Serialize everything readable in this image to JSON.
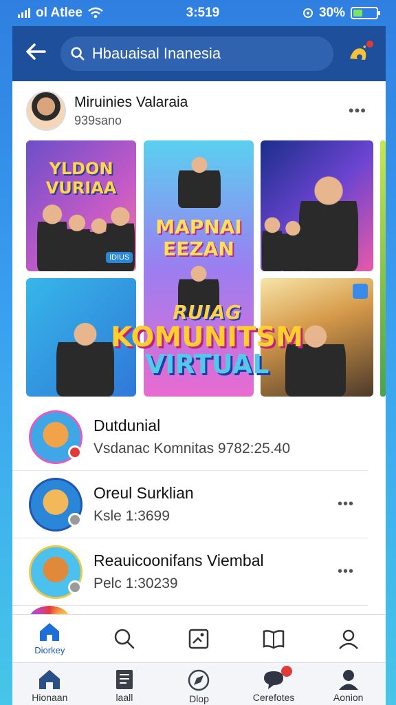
{
  "status_bar": {
    "carrier": "ol Atlee",
    "time": "3:519",
    "battery_percent": "30%",
    "battery_level": 0.4
  },
  "header": {
    "search_value": "Hbauaisal Inanesia",
    "icons": {
      "back": "back-arrow-icon",
      "search": "search-icon",
      "notifications": "notification-icon"
    }
  },
  "post": {
    "author_name": "Miruinies Valaraia",
    "author_sub": "939sano",
    "tiles": [
      {
        "caption_line1": "YLDON",
        "caption_line2": "VURIAA"
      },
      {
        "caption_line1": "MAPNAI",
        "caption_line2": "EEZAN"
      }
    ],
    "tile_badge_left": "IDIUS",
    "banner": {
      "line1": "RUIAG",
      "line2": "KOMUNITSM",
      "line3": "VIRTUAL"
    }
  },
  "list": [
    {
      "title": "Dutdunial",
      "subtitle": "Vsdanac Komnitas 9782:25.40"
    },
    {
      "title": "Oreul Surklian",
      "subtitle": "Ksle 1:3699"
    },
    {
      "title": "Reauicoonifans Viembal",
      "subtitle": "Pelc 1:30239"
    }
  ],
  "tabs": [
    {
      "label": "Diorkey",
      "icon": "home-icon"
    },
    {
      "label": "",
      "icon": "search-icon"
    },
    {
      "label": "",
      "icon": "photo-edit-icon"
    },
    {
      "label": "",
      "icon": "book-heart-icon"
    },
    {
      "label": "",
      "icon": "profile-icon"
    }
  ],
  "bottom_nav": [
    {
      "label": "Hionaan",
      "icon": "home-icon"
    },
    {
      "label": "laall",
      "icon": "document-icon"
    },
    {
      "label": "Dlop",
      "icon": "compass-icon"
    },
    {
      "label": "Cerefotes",
      "icon": "chat-icon",
      "badge": true
    },
    {
      "label": "Aonion",
      "icon": "person-icon"
    }
  ],
  "colors": {
    "header_bg": "#1e4f9a",
    "accent": "#1e56b0",
    "badge": "#e23a3a"
  }
}
